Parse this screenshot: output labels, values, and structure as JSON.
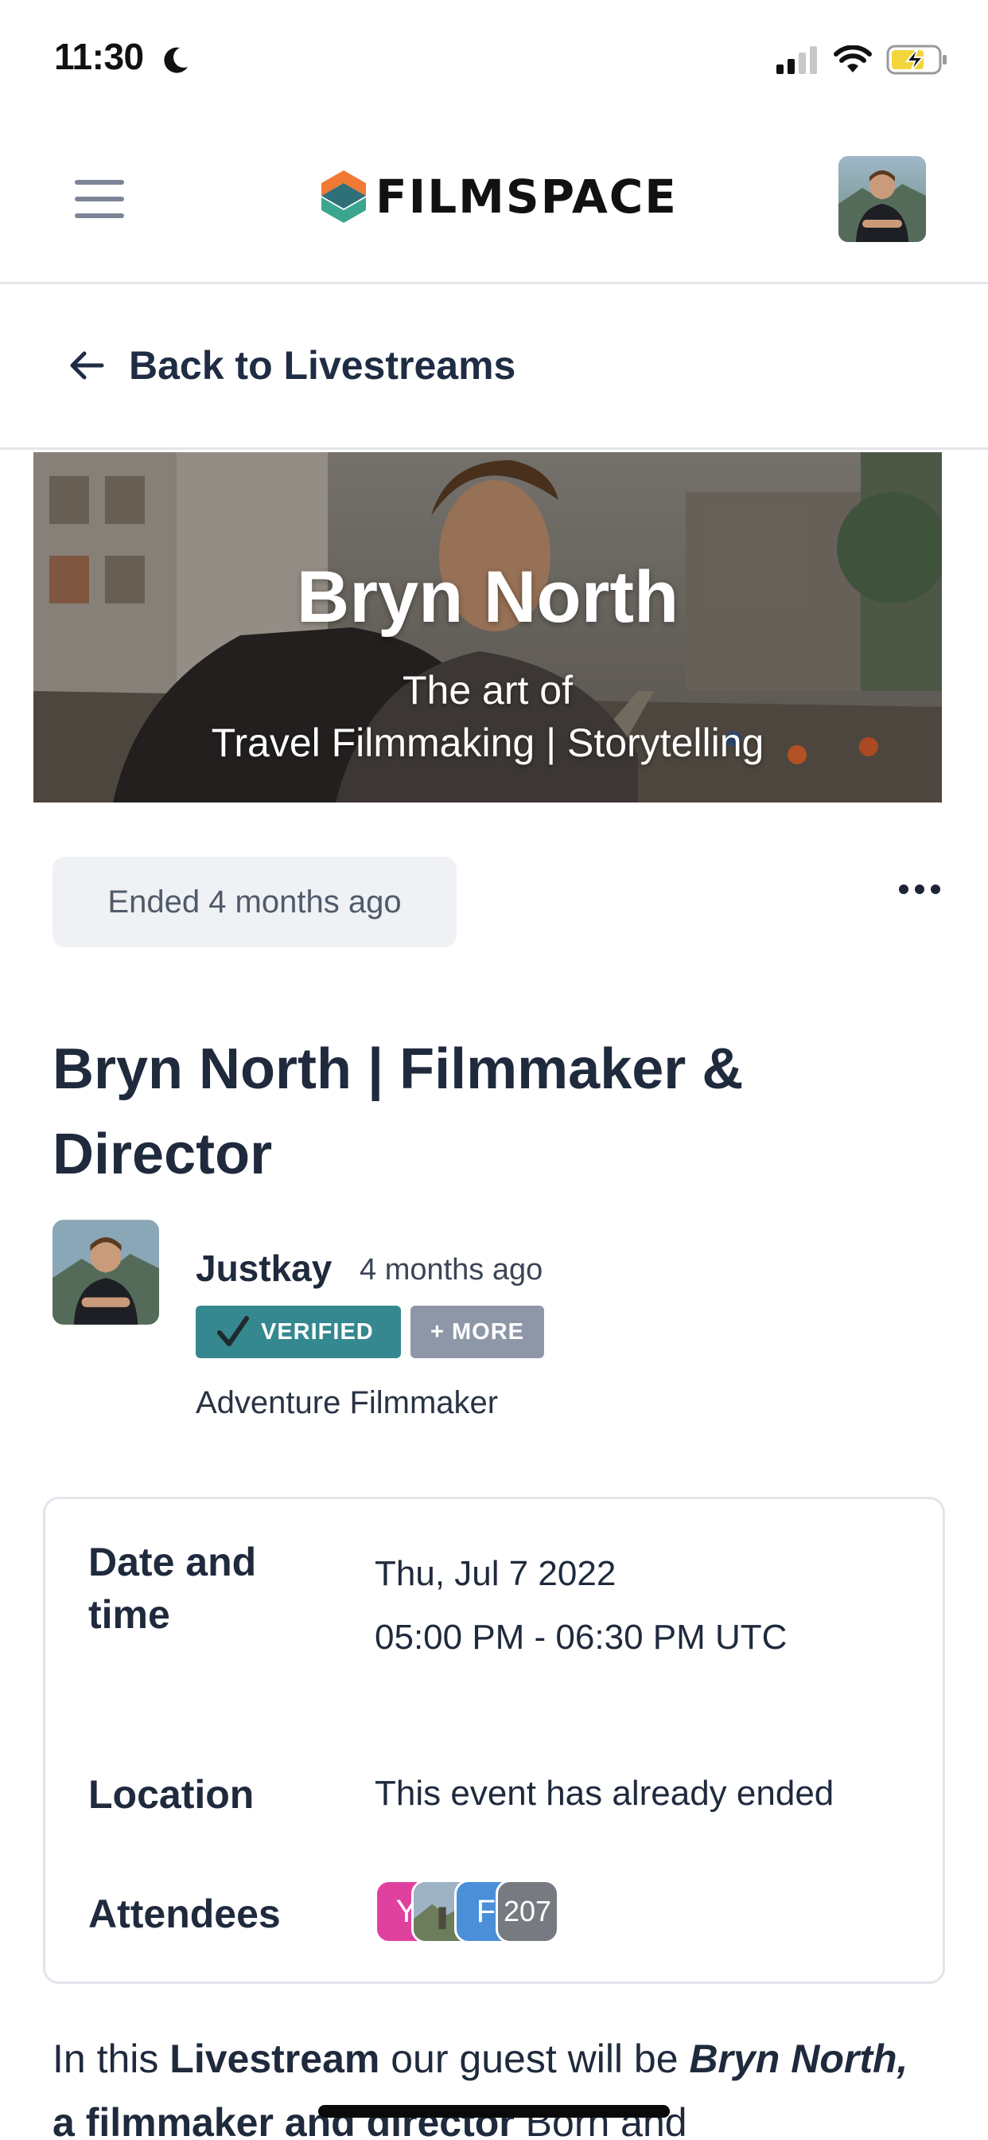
{
  "status_bar": {
    "time": "11:30"
  },
  "header": {
    "brand": "FILMSPACE"
  },
  "nav": {
    "back_label": "Back to Livestreams"
  },
  "banner": {
    "name": "Bryn North",
    "subtitle_line1": "The art of",
    "subtitle_line2": "Travel Filmmaking | Storytelling"
  },
  "event": {
    "status": "Ended 4 months ago",
    "title": "Bryn North | Filmmaker & Director"
  },
  "host": {
    "name": "Justkay",
    "posted": "4 months ago",
    "verified_badge": "VERIFIED",
    "more_badge": "+ MORE",
    "role": "Adventure Filmmaker"
  },
  "details": {
    "date_label": "Date and time",
    "date_value": "Thu, Jul 7 2022",
    "time_value": "05:00 PM - 06:30 PM UTC",
    "location_label": "Location",
    "location_value": "This event has already ended",
    "attendees_label": "Attendees",
    "attendees": [
      {
        "initial": "Y",
        "color": "#e0419f"
      },
      {
        "initial": "",
        "color": "#7e9bb5"
      },
      {
        "initial": "F",
        "color": "#4a8fd8"
      }
    ],
    "attendees_more": "207"
  },
  "description": {
    "t1": "In this ",
    "t2": "Livestream",
    "t3": " our guest will be ",
    "t4": "Bryn North,",
    "t5": " a filmmaker and director",
    "t6": " Born and"
  },
  "colors": {
    "accent_teal": "#35888f",
    "text_dark": "#1f2a3d",
    "badge_gray": "#8e97a7"
  }
}
